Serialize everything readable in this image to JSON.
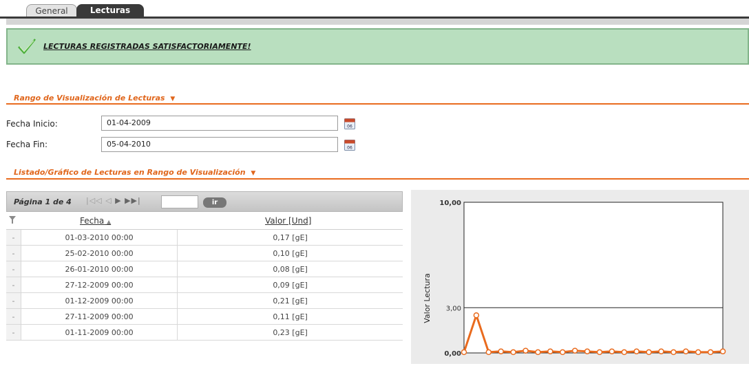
{
  "tabs": [
    {
      "label": "General",
      "active": false
    },
    {
      "label": "Lecturas",
      "active": true
    }
  ],
  "message": {
    "text": "LECTURAS REGISTRADAS SATISFACTORIAMENTE!",
    "icon": "check-icon"
  },
  "range_section": {
    "title": "Rango de Visualización de Lecturas",
    "fecha_inicio_label": "Fecha Inicio:",
    "fecha_inicio_value": "01-04-2009",
    "fecha_fin_label": "Fecha Fin:",
    "fecha_fin_value": "05-04-2010",
    "calendar_icon_text": "06"
  },
  "list_section": {
    "title": "Listado/Gráfico de Lecturas en Rango de Visualización"
  },
  "pager": {
    "text": "Página 1 de 4",
    "go_label": "ir",
    "input_value": ""
  },
  "table": {
    "headers": [
      "Fecha",
      "Valor [Und]"
    ],
    "rows": [
      {
        "mark": "-",
        "fecha": "01-03-2010 00:00",
        "valor": "0,17 [gE]"
      },
      {
        "mark": "-",
        "fecha": "25-02-2010 00:00",
        "valor": "0,10 [gE]"
      },
      {
        "mark": "-",
        "fecha": "26-01-2010 00:00",
        "valor": "0,08 [gE]"
      },
      {
        "mark": "-",
        "fecha": "27-12-2009 00:00",
        "valor": "0,09 [gE]"
      },
      {
        "mark": "-",
        "fecha": "01-12-2009 00:00",
        "valor": "0,21 [gE]"
      },
      {
        "mark": "-",
        "fecha": "27-11-2009 00:00",
        "valor": "0,11 [gE]"
      },
      {
        "mark": "-",
        "fecha": "01-11-2009 00:00",
        "valor": "0,23 [gE]"
      }
    ]
  },
  "colors": {
    "accent": "#e96b1e",
    "success_bg": "#b9dfbf",
    "line": "#e96b1e"
  },
  "chart_data": {
    "type": "line",
    "ylabel": "Valor Lectura",
    "ylim": [
      0,
      10
    ],
    "ytick_labels": [
      "10,00",
      "3,00",
      "0,00"
    ],
    "ytick_values": [
      10,
      3,
      0
    ],
    "reference_line": 3,
    "grid": false,
    "x": [
      1,
      2,
      3,
      4,
      5,
      6,
      7,
      8,
      9,
      10,
      11,
      12,
      13,
      14,
      15,
      16,
      17,
      18,
      19,
      20,
      21,
      22
    ],
    "series": [
      {
        "values": [
          0.05,
          2.5,
          0.05,
          0.1,
          0.05,
          0.15,
          0.05,
          0.1,
          0.05,
          0.15,
          0.1,
          0.05,
          0.1,
          0.05,
          0.1,
          0.05,
          0.1,
          0.05,
          0.1,
          0.05,
          0.05,
          0.1
        ]
      }
    ]
  }
}
